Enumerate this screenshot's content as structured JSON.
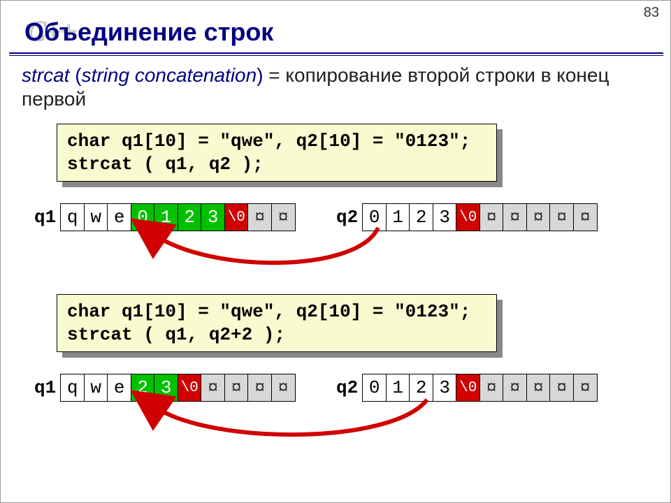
{
  "page_number": "83",
  "logo_text": "C++",
  "title": "Объединение строк",
  "subtitle": {
    "fn": "strcat",
    "italic_desc": "string concatenation",
    "rest": " = копирование второй строки в конец первой"
  },
  "code1": "char q1[10] = \"qwe\", q2[10] = \"0123\";\nstrcat ( q1, q2 );",
  "code2": "char q1[10] = \"qwe\", q2[10] = \"0123\";\nstrcat ( q1, q2+2 );",
  "labels": {
    "q1": "q1",
    "q2": "q2"
  },
  "arrays": {
    "ex1_q1": [
      {
        "v": "q",
        "c": "w"
      },
      {
        "v": "w",
        "c": "w"
      },
      {
        "v": "e",
        "c": "w"
      },
      {
        "v": "0",
        "c": "g"
      },
      {
        "v": "1",
        "c": "g"
      },
      {
        "v": "2",
        "c": "g"
      },
      {
        "v": "3",
        "c": "g"
      },
      {
        "v": "\\0",
        "c": "r"
      },
      {
        "v": "¤",
        "c": "gr"
      },
      {
        "v": "¤",
        "c": "gr"
      }
    ],
    "ex1_q2": [
      {
        "v": "0",
        "c": "w"
      },
      {
        "v": "1",
        "c": "w"
      },
      {
        "v": "2",
        "c": "w"
      },
      {
        "v": "3",
        "c": "w"
      },
      {
        "v": "\\0",
        "c": "r"
      },
      {
        "v": "¤",
        "c": "gr"
      },
      {
        "v": "¤",
        "c": "gr"
      },
      {
        "v": "¤",
        "c": "gr"
      },
      {
        "v": "¤",
        "c": "gr"
      },
      {
        "v": "¤",
        "c": "gr"
      }
    ],
    "ex2_q1": [
      {
        "v": "q",
        "c": "w"
      },
      {
        "v": "w",
        "c": "w"
      },
      {
        "v": "e",
        "c": "w"
      },
      {
        "v": "2",
        "c": "g"
      },
      {
        "v": "3",
        "c": "g"
      },
      {
        "v": "\\0",
        "c": "r"
      },
      {
        "v": "¤",
        "c": "gr"
      },
      {
        "v": "¤",
        "c": "gr"
      },
      {
        "v": "¤",
        "c": "gr"
      },
      {
        "v": "¤",
        "c": "gr"
      }
    ],
    "ex2_q2": [
      {
        "v": "0",
        "c": "w"
      },
      {
        "v": "1",
        "c": "w"
      },
      {
        "v": "2",
        "c": "w"
      },
      {
        "v": "3",
        "c": "w"
      },
      {
        "v": "\\0",
        "c": "r"
      },
      {
        "v": "¤",
        "c": "gr"
      },
      {
        "v": "¤",
        "c": "gr"
      },
      {
        "v": "¤",
        "c": "gr"
      },
      {
        "v": "¤",
        "c": "gr"
      },
      {
        "v": "¤",
        "c": "gr"
      }
    ]
  }
}
